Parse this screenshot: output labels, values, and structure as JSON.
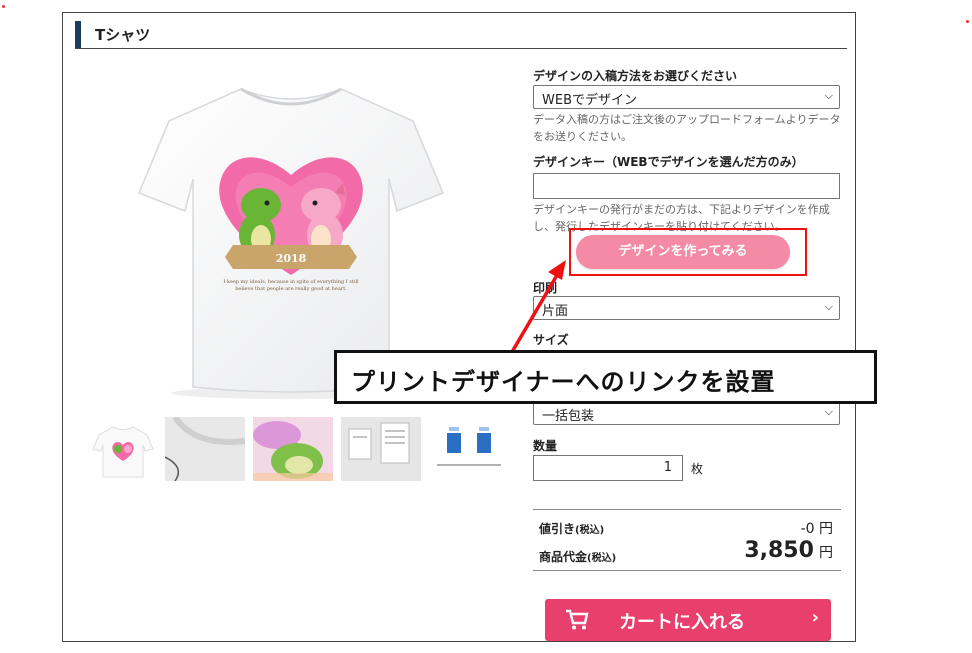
{
  "section": {
    "title": "Tシャツ"
  },
  "shirt": {
    "year": "2018",
    "caption_line1": "I keep my ideals, because in spite of everything I still",
    "caption_line2": "believe that people are really good at heart."
  },
  "form": {
    "input_method_label": "デザインの入稿方法をお選びください",
    "input_method_value": "WEBでデザイン",
    "input_method_help": "データ入稿の方はご注文後のアップロードフォームよりデータをお送りください。",
    "design_key_label": "デザインキー（WEBでデザインを選んだ方のみ）",
    "design_key_value": "",
    "design_key_help": "デザインキーの発行がまだの方は、下記よりデザインを作成し、発行したデザインキーを貼り付けてください。",
    "design_button": "デザインを作ってみる",
    "print_label": "印刷",
    "print_value": "片面",
    "size_label": "サイズ",
    "packaging_value": "一括包装",
    "quantity_label": "数量",
    "quantity_value": "1",
    "quantity_unit": "枚"
  },
  "totals": {
    "discount_label": "値引き",
    "discount_tax": "(税込)",
    "discount_value": "-0",
    "discount_unit": "円",
    "price_label": "商品代金",
    "price_tax": "(税込)",
    "price_value": "3,850",
    "price_unit": "円"
  },
  "cart_button": "カートに入れる",
  "annotation": "プリントデザイナーへのリンクを設置",
  "colors": {
    "accent": "#e93f6c",
    "design_button": "#f48aa3",
    "highlight": "#e11111",
    "title_bar": "#1e3a5c"
  },
  "icons": [
    "cart-icon",
    "chevron-right-icon",
    "chevron-down-icon"
  ]
}
